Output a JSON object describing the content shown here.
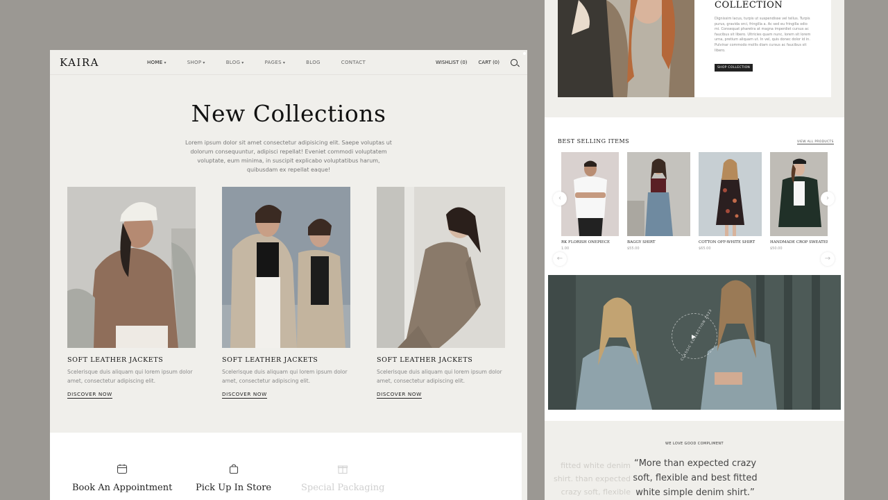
{
  "colors": {
    "background": "#9b9893",
    "panel": "#f0efeb",
    "white": "#ffffff",
    "dark": "#222222"
  },
  "left": {
    "logo": "KAIRA",
    "menu": [
      "HOME",
      "SHOP",
      "BLOG",
      "PAGES",
      "BLOG",
      "CONTACT"
    ],
    "wishlist": "WISHLIST (0)",
    "cart": "CART (0)",
    "title": "New Collections",
    "intro": "Lorem ipsum dolor sit amet consectetur adipisicing elit. Saepe voluptas ut dolorum consequuntur, adipisci repellat! Eveniet commodi voluptatem voluptate, eum minima, in suscipit explicabo voluptatibus harum, quibusdam ex repellat eaque!",
    "products": [
      {
        "title": "SOFT LEATHER JACKETS",
        "desc": "Scelerisque duis aliquam qui lorem ipsum dolor amet, consectetur adipiscing elit.",
        "link": "DISCOVER NOW"
      },
      {
        "title": "SOFT LEATHER JACKETS",
        "desc": "Scelerisque duis aliquam qui lorem ipsum dolor amet, consectetur adipiscing elit.",
        "link": "DISCOVER NOW"
      },
      {
        "title": "SOFT LEATHER JACKETS",
        "desc": "Scelerisque duis aliquam qui lorem ipsum dolor amet, consectetur adipiscing elit.",
        "link": "DISCOVER NOW"
      }
    ],
    "services": [
      {
        "label": "Book An Appointment",
        "icon": "calendar-icon"
      },
      {
        "label": "Pick Up In Store",
        "icon": "shopping-bag-icon"
      },
      {
        "label": "Special Packaging",
        "icon": "gift-icon"
      }
    ]
  },
  "right": {
    "collection_title": "COLLECTION",
    "collection_text": "Dignissim lacus, turpis ut suspendisse vel tellus. Turpis purus, gravida orci, fringilla a. Ac sed eu fringilla odio mi. Consequat pharetra at magna imperdiet cursus ac faucibus sit libero. Ultricies quam nunc, lorem sit lorem urna, pretium aliquam ut. In vel, quis donec dolor id in. Pulvinar commodo mollis diam cursus ac faucibus sit libero.",
    "collection_button": "SHOP COLLECTION",
    "best_title": "BEST SELLING ITEMS",
    "view_all": "VIEW ALL PRODUCTS",
    "items": [
      {
        "name": "RK FLORISH ONEPIECE",
        "price": "1.00"
      },
      {
        "name": "BAGGY SHIRT",
        "price": "$55.00"
      },
      {
        "name": "COTTON OFF-WHITE SHIRT",
        "price": "$65.00"
      },
      {
        "name": "HANDMADE CROP SWEATER",
        "price": "$50.00"
      }
    ],
    "badge_text": "CLASSIC COLLECTION 2023",
    "testimonial_heading": "WE LOVE GOOD COMPLIMENT",
    "quote": "“More than expected crazy soft, flexible and best fitted white simple denim shirt.”",
    "quote_faded": "fitted white denim shirt. than expected crazy soft, flexible"
  }
}
